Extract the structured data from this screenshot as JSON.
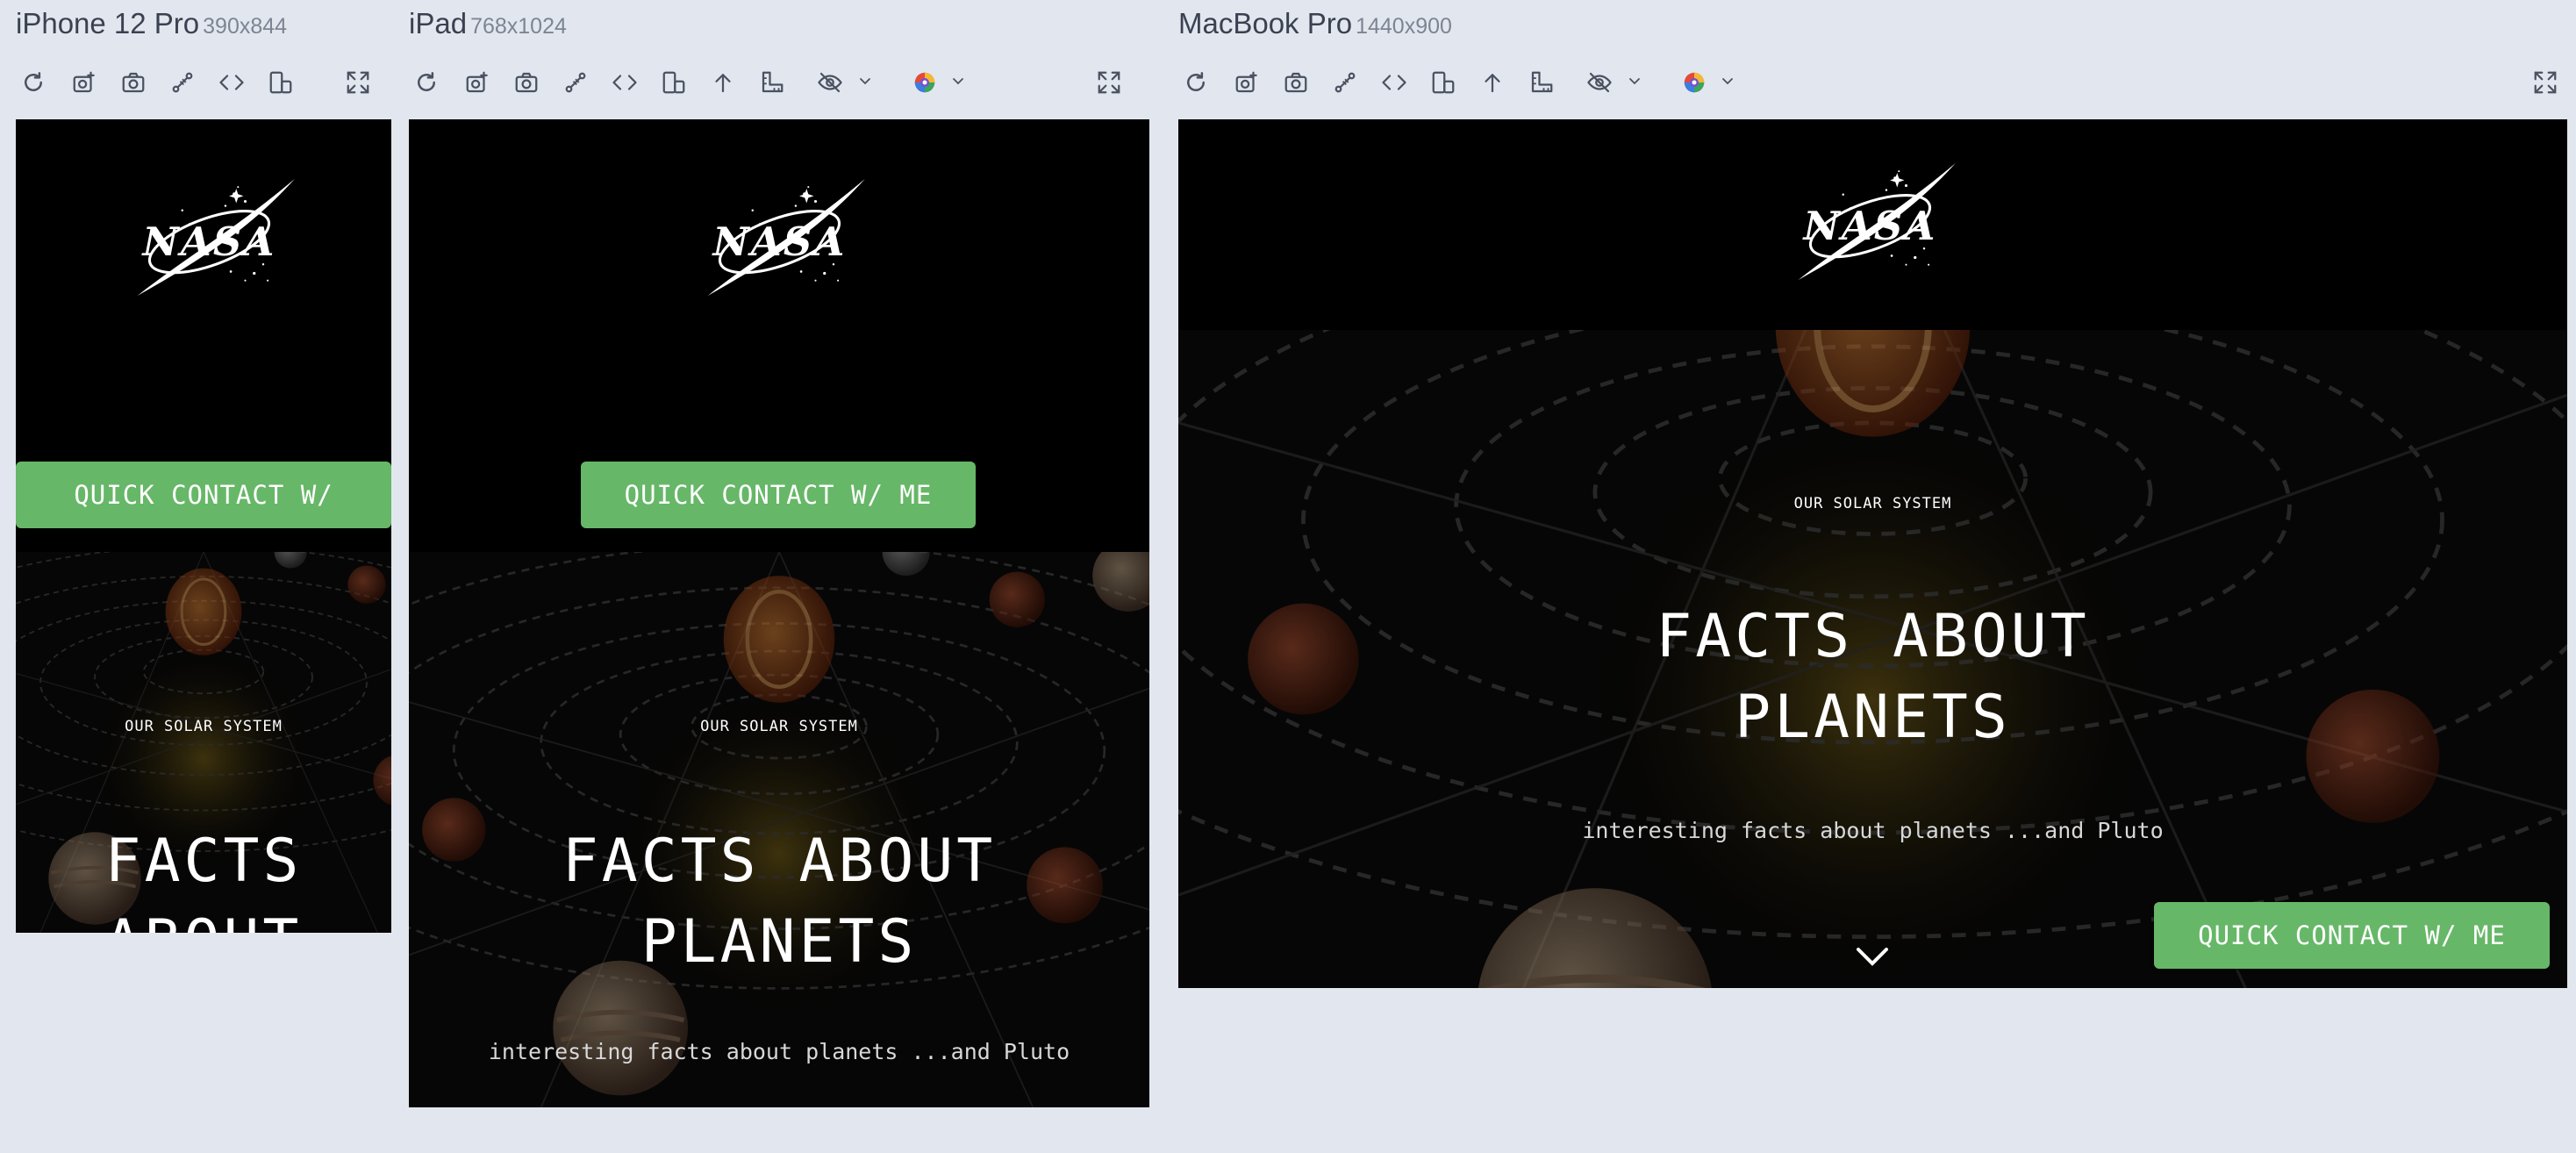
{
  "devices": [
    {
      "name": "iPhone 12 Pro",
      "size": "390x844"
    },
    {
      "name": "iPad",
      "size": "768x1024"
    },
    {
      "name": "MacBook Pro",
      "size": "1440x900"
    }
  ],
  "toolbar_icons": [
    "refresh-icon",
    "screenshot-full-icon",
    "camera-icon",
    "sync-scroll-icon",
    "code-icon",
    "rotate-icon",
    "scroll-top-icon",
    "ruler-icon",
    "hide-icon",
    "color-vision-icon",
    "fullscreen-icon"
  ],
  "site": {
    "logo_text": "NASA",
    "eyebrow": "OUR SOLAR SYSTEM",
    "title_line1": "FACTS ABOUT",
    "title_line2": "PLANETS",
    "subtitle": "interesting facts about planets ...and Pluto",
    "contact_button": "QUICK CONTACT W/ ME",
    "mobile_contact_button": "QUICK CONTACT W/"
  },
  "colors": {
    "page_background": "#e2e7ef",
    "button_green": "#67b768",
    "site_background": "#000000"
  }
}
